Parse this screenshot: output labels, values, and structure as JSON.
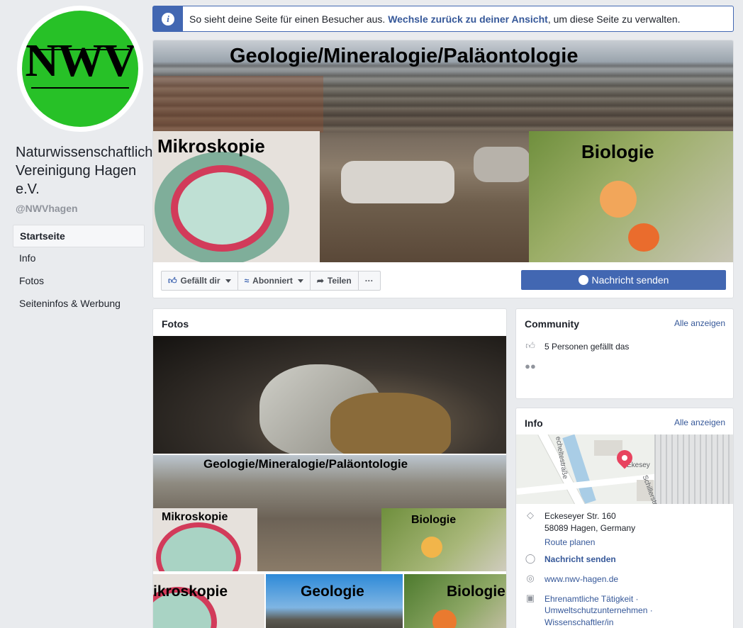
{
  "left": {
    "avatar_text": "NWV",
    "page_name": "Naturwissenschaftliche Vereinigung Hagen e.V.",
    "handle": "@NWVhagen",
    "nav": [
      {
        "label": "Startseite",
        "active": true
      },
      {
        "label": "Info",
        "active": false
      },
      {
        "label": "Fotos",
        "active": false
      },
      {
        "label": "Seiteninfos & Werbung",
        "active": false
      }
    ]
  },
  "notice": {
    "icon": "info-icon",
    "text_before": "So sieht deine Seite für einen Besucher aus. ",
    "link": "Wechsle zurück zu deiner Ansicht",
    "text_after": ", um diese Seite zu verwalten."
  },
  "cover": {
    "title": "Geologie/Mineralogie/Paläontologie",
    "left_label": "Mikroskopie",
    "right_label": "Biologie"
  },
  "actions": {
    "like": "Gefällt dir",
    "follow": "Abonniert",
    "share": "Teilen",
    "more": "···",
    "message": "Nachricht senden"
  },
  "fotos": {
    "title": "Fotos",
    "photo2_title": "Geologie/Mineralogie/Paläontologie",
    "photo2_left": "Mikroskopie",
    "photo2_right": "Biologie",
    "photo3_labels": [
      "ikroskopie",
      "Geologie",
      "Biologie"
    ]
  },
  "community": {
    "title": "Community",
    "see_all": "Alle anzeigen",
    "likes": "5 Personen gefällt das",
    "follows": ""
  },
  "info": {
    "title": "Info",
    "see_all": "Alle anzeigen",
    "map_labels": [
      "echeltestraße",
      "Ekesey",
      "Schillerstr"
    ],
    "address_line1": "Eckeseyer Str. 160",
    "address_line2": "58089 Hagen, Germany",
    "route": "Route planen",
    "message": "Nachricht senden",
    "website": "www.nwv-hagen.de",
    "categories": [
      "Ehrenamtliche Tätigkeit ·",
      "Umweltschutzunternehmen ·",
      "Wissenschaftler/in"
    ]
  },
  "colors": {
    "brand_blue": "#4267b2",
    "link_blue": "#365899",
    "avatar_green": "#27c127",
    "page_bg": "#e9ebee"
  }
}
